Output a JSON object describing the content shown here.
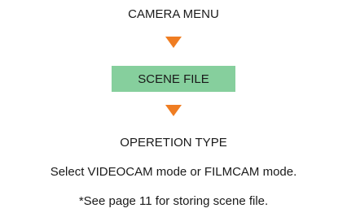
{
  "colors": {
    "arrow": "#ef7d22",
    "box_fill": "#86cf9d",
    "text": "#1a1a1a"
  },
  "steps": [
    {
      "label": "CAMERA MENU"
    },
    {
      "label": "SCENE FILE"
    },
    {
      "label": "OPERETION TYPE"
    }
  ],
  "notes": {
    "instruction": "Select VIDEOCAM mode or FILMCAM mode.",
    "reference": "*See page 11 for storing scene file."
  }
}
